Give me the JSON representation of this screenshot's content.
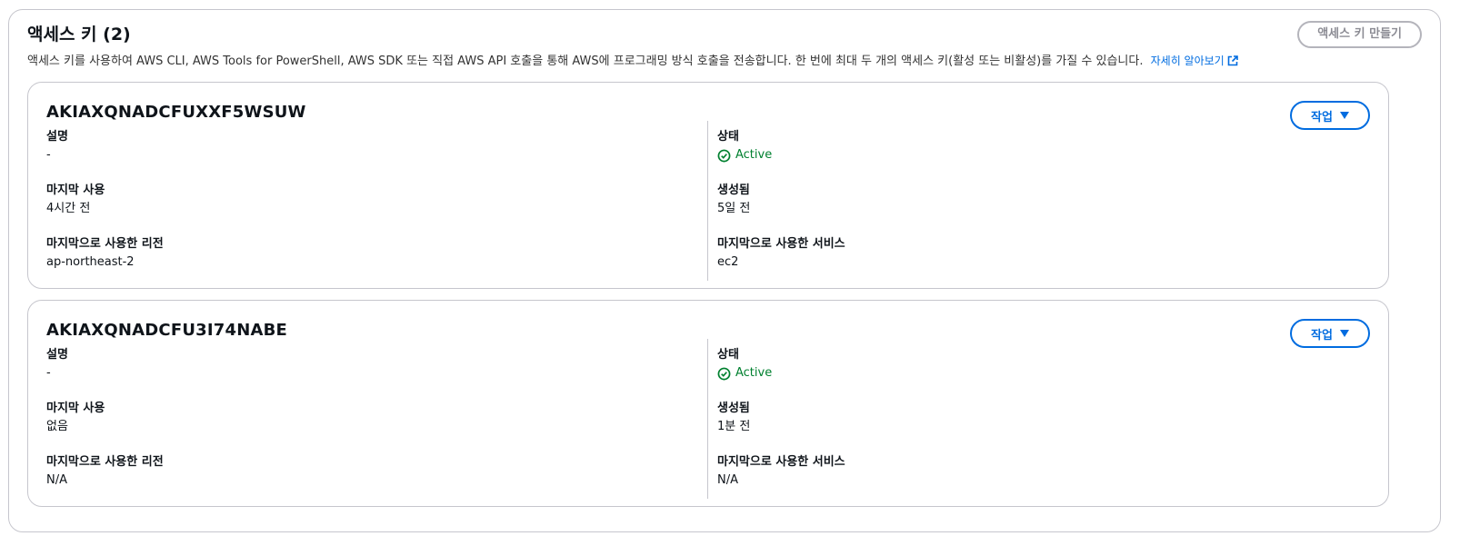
{
  "panel": {
    "title": "액세스 키 (2)",
    "description": "액세스 키를 사용하여 AWS CLI, AWS Tools for PowerShell, AWS SDK 또는 직접 AWS API 호출을 통해 AWS에 프로그래밍 방식 호출을 전송합니다. 한 번에 최대 두 개의 액세스 키(활성 또는 비활성)를 가질 수 있습니다.",
    "learn_more": "자세히 알아보기",
    "create_button": "액세스 키 만들기"
  },
  "labels": {
    "description": "설명",
    "last_used": "마지막 사용",
    "last_region": "마지막으로 사용한 리전",
    "status": "상태",
    "created": "생성됨",
    "last_service": "마지막으로 사용한 서비스",
    "action": "작업"
  },
  "keys": [
    {
      "id": "AKIAXQNADCFUXXF5WSUW",
      "description": "-",
      "last_used": "4시간 전",
      "last_region": "ap-northeast-2",
      "status": "Active",
      "created": "5일 전",
      "last_service": "ec2"
    },
    {
      "id": "AKIAXQNADCFU3I74NABE",
      "description": "-",
      "last_used": "없음",
      "last_region": "N/A",
      "status": "Active",
      "created": "1분 전",
      "last_service": "N/A"
    }
  ],
  "colors": {
    "accent": "#006ce0",
    "success": "#00802f",
    "border": "#c6c6cd"
  },
  "icons": {
    "external": "external-link-icon",
    "status": "check-circle-icon",
    "dropdown": "caret-down-icon"
  }
}
